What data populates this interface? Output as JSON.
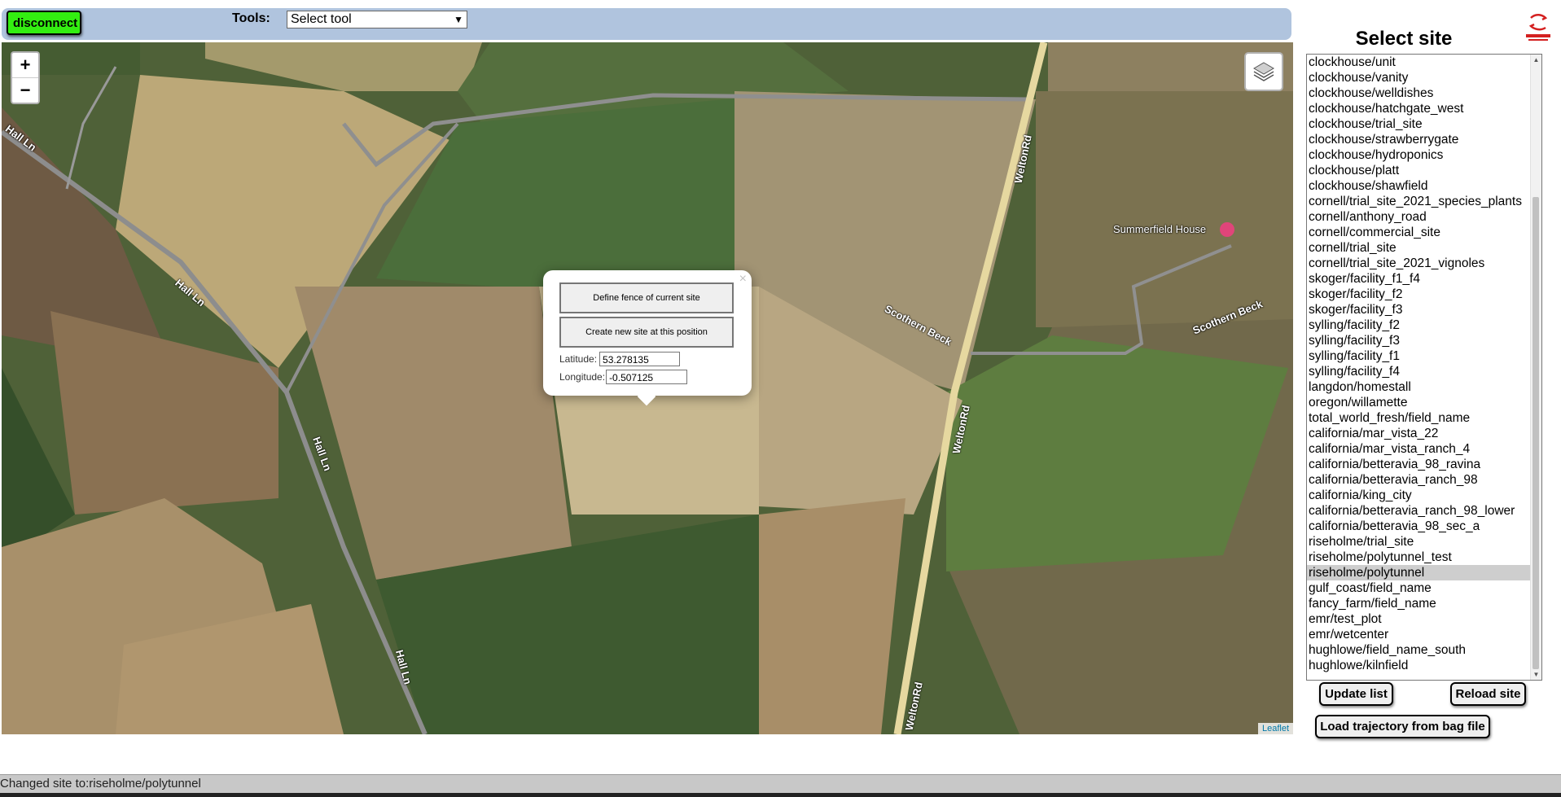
{
  "toolbar": {
    "disconnect_label": "disconnect",
    "tools_label": "Tools:",
    "tool_select_value": "Select tool"
  },
  "map": {
    "zoom_in": "+",
    "zoom_out": "−",
    "attribution": "Leaflet",
    "road_labels": [
      "Hall Ln",
      "Hall Ln",
      "Hall Ln",
      "Hall Ln",
      "WeltonRd",
      "WeltonRd",
      "WeltonRd",
      "Scothern Beck",
      "Scothern Beck"
    ],
    "poi_label": "Summerfield House",
    "popup": {
      "define_fence_label": "Define fence of current site",
      "create_site_label": "Create new site at this position",
      "latitude_label": "Latitude:",
      "latitude_value": "53.278135",
      "longitude_label": "Longitude:",
      "longitude_value": "-0.507125",
      "close_label": "×"
    }
  },
  "sidebar": {
    "title": "Select site",
    "sites": [
      "clockhouse/unit",
      "clockhouse/vanity",
      "clockhouse/welldishes",
      "clockhouse/hatchgate_west",
      "clockhouse/trial_site",
      "clockhouse/strawberrygate",
      "clockhouse/hydroponics",
      "clockhouse/platt",
      "clockhouse/shawfield",
      "cornell/trial_site_2021_species_plants",
      "cornell/anthony_road",
      "cornell/commercial_site",
      "cornell/trial_site",
      "cornell/trial_site_2021_vignoles",
      "skoger/facility_f1_f4",
      "skoger/facility_f2",
      "skoger/facility_f3",
      "sylling/facility_f2",
      "sylling/facility_f3",
      "sylling/facility_f1",
      "sylling/facility_f4",
      "langdon/homestall",
      "oregon/willamette",
      "total_world_fresh/field_name",
      "california/mar_vista_22",
      "california/mar_vista_ranch_4",
      "california/betteravia_98_ravina",
      "california/betteravia_ranch_98",
      "california/king_city",
      "california/betteravia_ranch_98_lower",
      "california/betteravia_98_sec_a",
      "riseholme/trial_site",
      "riseholme/polytunnel_test",
      "riseholme/polytunnel",
      "gulf_coast/field_name",
      "fancy_farm/field_name",
      "emr/test_plot",
      "emr/wetcenter",
      "hughlowe/field_name_south",
      "hughlowe/kilnfield"
    ],
    "selected_site": "riseholme/polytunnel",
    "update_list_label": "Update list",
    "reload_site_label": "Reload site",
    "load_trajectory_label": "Load trajectory from bag file"
  },
  "status": {
    "message": "Changed site to:riseholme/polytunnel"
  }
}
